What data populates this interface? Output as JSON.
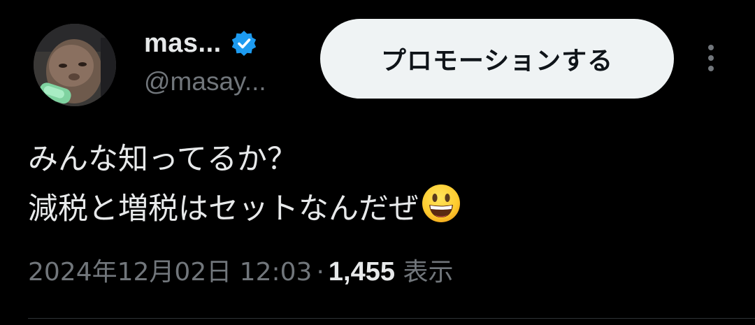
{
  "author": {
    "display_name": "mas...",
    "handle": "@masay...",
    "verified": true,
    "verified_color": "#1d9bf0"
  },
  "header": {
    "promote_label": "プロモーションする",
    "more_icon": "more-vertical-icon"
  },
  "tweet": {
    "lines": [
      "みんな知ってるか？",
      "減税と増税はセットなんだぜ"
    ],
    "emoji": "grinning-face-icon"
  },
  "meta": {
    "timestamp": "2024年12月02日 12:03",
    "separator": "·",
    "views_count": "1,455",
    "views_label": "表示"
  },
  "colors": {
    "background": "#000000",
    "text_primary": "#e7e9ea",
    "text_secondary": "#71767b",
    "button_bg": "#eff3f4"
  }
}
